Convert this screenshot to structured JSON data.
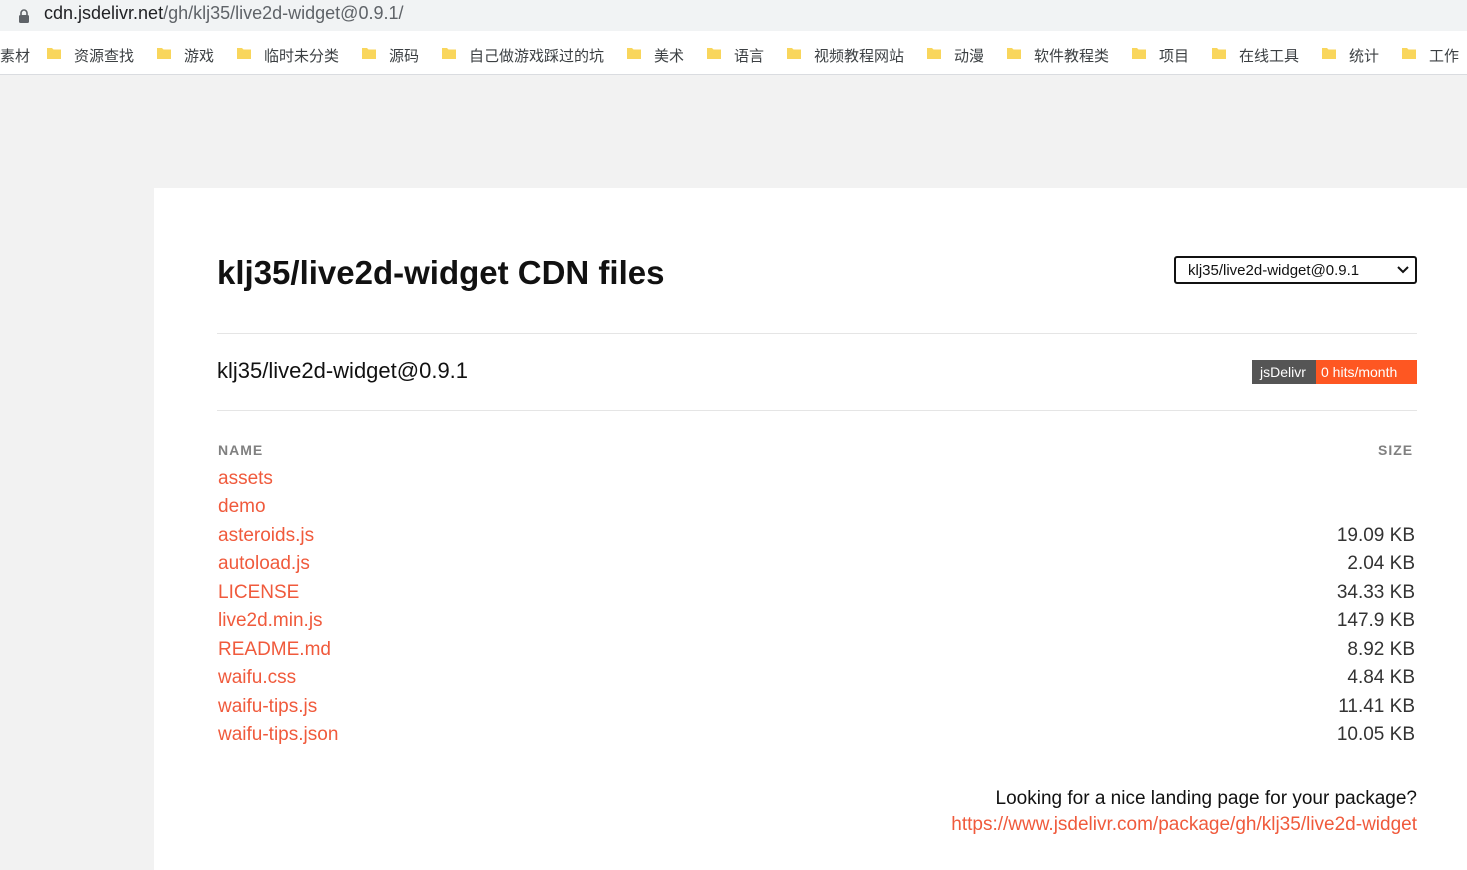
{
  "browser": {
    "url_host": "cdn.jsdelivr.net",
    "url_path": "/gh/klj35/live2d-widget@0.9.1/",
    "bookmarks": [
      {
        "label": "素材"
      },
      {
        "label": "资源查找"
      },
      {
        "label": "游戏"
      },
      {
        "label": "临时未分类"
      },
      {
        "label": "源码"
      },
      {
        "label": "自己做游戏踩过的坑"
      },
      {
        "label": "美术"
      },
      {
        "label": "语言"
      },
      {
        "label": "视频教程网站"
      },
      {
        "label": "动漫"
      },
      {
        "label": "软件教程类"
      },
      {
        "label": "项目"
      },
      {
        "label": "在线工具"
      },
      {
        "label": "统计"
      },
      {
        "label": "工作"
      }
    ]
  },
  "page": {
    "title": "klj35/live2d-widget CDN files",
    "version_select": {
      "value": "klj35/live2d-widget@0.9.1"
    },
    "package_name": "klj35/live2d-widget@0.9.1",
    "badge": {
      "left": "jsDelivr",
      "right": "0 hits/month",
      "left_color": "#555555",
      "right_color": "#fe5722"
    },
    "columns": {
      "name": "NAME",
      "size": "SIZE"
    },
    "files": [
      {
        "name": "assets",
        "size": ""
      },
      {
        "name": "demo",
        "size": ""
      },
      {
        "name": "asteroids.js",
        "size": "19.09 KB"
      },
      {
        "name": "autoload.js",
        "size": "2.04 KB"
      },
      {
        "name": "LICENSE",
        "size": "34.33 KB"
      },
      {
        "name": "live2d.min.js",
        "size": "147.9 KB"
      },
      {
        "name": "README.md",
        "size": "8.92 KB"
      },
      {
        "name": "waifu.css",
        "size": "4.84 KB"
      },
      {
        "name": "waifu-tips.js",
        "size": "11.41 KB"
      },
      {
        "name": "waifu-tips.json",
        "size": "10.05 KB"
      }
    ],
    "landing_question": "Looking for a nice landing page for your package?",
    "landing_link": "https://www.jsdelivr.com/package/gh/klj35/live2d-widget",
    "link_color": "#f05a3c"
  }
}
